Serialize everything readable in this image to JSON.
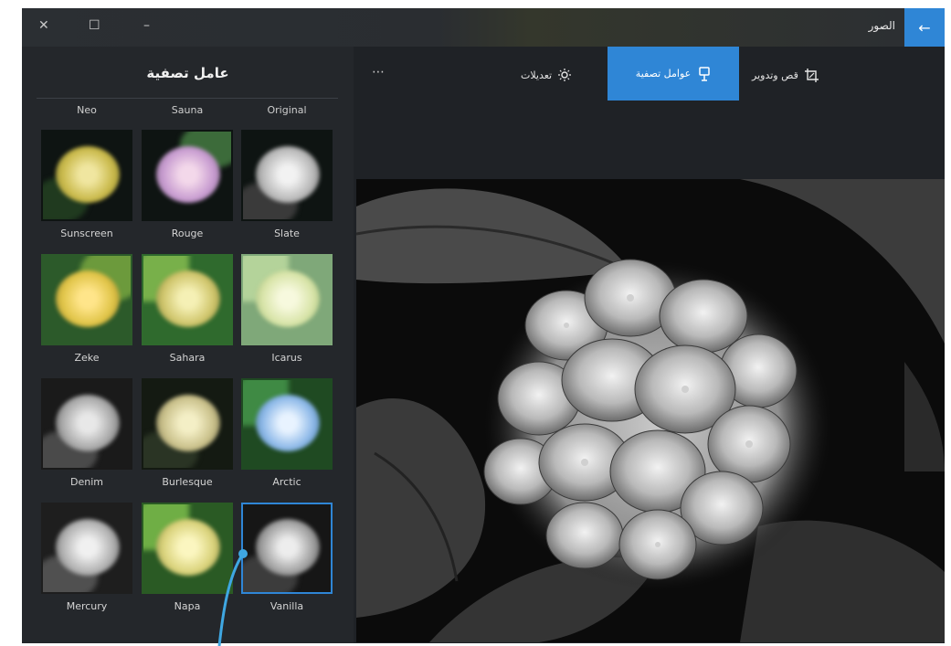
{
  "titlebar": {
    "title": "الصور",
    "back_icon": "←",
    "close_icon": "✕",
    "restore_icon": "☐",
    "minimize_icon": "–"
  },
  "toolbar": {
    "crop_label": "قص وتدوير",
    "filters_label": "عوامل تصفية",
    "adjust_label": "تعديلات",
    "more_label": "⋯",
    "accent": "#2f86d6"
  },
  "filter_panel": {
    "title": "عامل تصفية",
    "top_labels": [
      "Neo",
      "Sauna",
      "Original"
    ],
    "rows": [
      [
        "Sunscreen",
        "Rouge",
        "Slate"
      ],
      [
        "Zeke",
        "Sahara",
        "Icarus"
      ],
      [
        "Denim",
        "Burlesque",
        "Arctic"
      ],
      [
        "Mercury",
        "Napa",
        "Vanilla"
      ]
    ],
    "selected": "Vanilla"
  }
}
